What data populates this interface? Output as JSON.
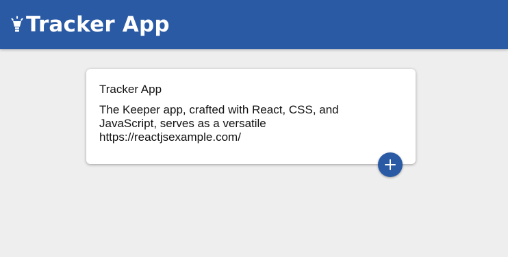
{
  "header": {
    "title": "Tracker App",
    "icon": "lightbulb-icon"
  },
  "note": {
    "title": "Tracker App",
    "content": "The Keeper app, crafted with React, CSS, and JavaScript, serves as a versatile https://reactjsexample.com/"
  },
  "actions": {
    "add_icon": "plus-icon"
  },
  "colors": {
    "primary": "#2a5aa4",
    "background": "#eeeeee",
    "card": "#ffffff",
    "text": "#111111"
  }
}
